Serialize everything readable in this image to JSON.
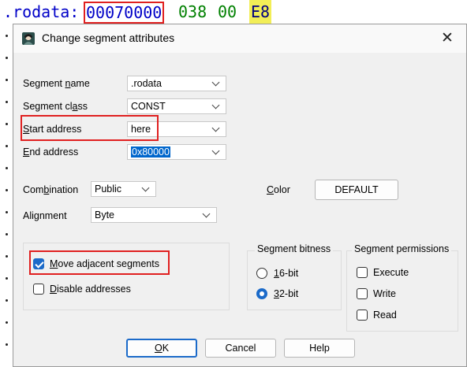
{
  "code_line": {
    "segment": ".rodata:",
    "address": "00070000",
    "byte1": "038",
    "byte2": "00",
    "byte3": "E8"
  },
  "dialog": {
    "title": "Change segment attributes",
    "fields": {
      "segment_name": {
        "label_pre": "Segment ",
        "label_u": "n",
        "label_post": "ame",
        "value": ".rodata"
      },
      "segment_class": {
        "label_pre": "Segment cl",
        "label_u": "a",
        "label_post": "ss",
        "value": "CONST"
      },
      "start_address": {
        "label_pre": "",
        "label_u": "S",
        "label_post": "tart address",
        "value": "here"
      },
      "end_address": {
        "label_pre": "",
        "label_u": "E",
        "label_post": "nd address",
        "value": "0x80000"
      },
      "combination": {
        "label_pre": "Com",
        "label_u": "b",
        "label_post": "ination",
        "value": "Public"
      },
      "alignment": {
        "label_pre": "Ali",
        "label_u": "g",
        "label_post": "nment",
        "value": "Byte"
      },
      "color": {
        "label_pre": "",
        "label_u": "C",
        "label_post": "olor",
        "button": "DEFAULT"
      }
    },
    "options": {
      "move_adjacent": {
        "label_pre": "",
        "label_u": "M",
        "label_post": "ove adjacent segments",
        "checked": true
      },
      "disable_addresses": {
        "label_pre": "",
        "label_u": "D",
        "label_post": "isable addresses",
        "checked": false
      }
    },
    "bitness": {
      "title": "Segment bitness",
      "bit16": {
        "label_pre": "",
        "label_u": "1",
        "label_post": "6-bit",
        "selected": false
      },
      "bit32": {
        "label_pre": "",
        "label_u": "3",
        "label_post": "2-bit",
        "selected": true
      }
    },
    "permissions": {
      "title": "Segment permissions",
      "execute": {
        "label": "Execute",
        "checked": false
      },
      "write": {
        "label": "Write",
        "checked": false
      },
      "read": {
        "label": "Read",
        "checked": false
      }
    },
    "buttons": {
      "ok": {
        "label_pre": "",
        "label_u": "O",
        "label_post": "K"
      },
      "cancel": "Cancel",
      "help": "Help"
    }
  },
  "colors": {
    "highlight": "#e02020",
    "accent": "#1b6ac9",
    "byte_highlight": "#f2ee57"
  }
}
